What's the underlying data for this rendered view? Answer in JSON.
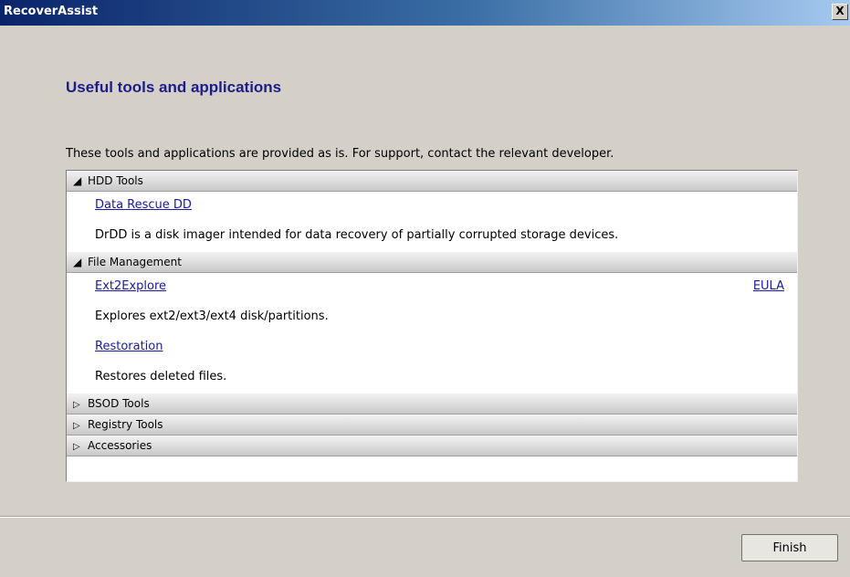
{
  "window": {
    "title": "RecoverAssist",
    "close_glyph": "X"
  },
  "page": {
    "heading": "Useful tools and applications",
    "intro": "These tools and applications are provided as is. For support, contact the relevant developer."
  },
  "groups": [
    {
      "name": "HDD Tools",
      "expanded": true,
      "items": [
        {
          "link": "Data Rescue DD",
          "description": "DrDD is a disk imager intended for data recovery of partially corrupted storage devices."
        }
      ]
    },
    {
      "name": "File Management",
      "expanded": true,
      "items": [
        {
          "link": "Ext2Explore",
          "extra_link": "EULA",
          "description": "Explores ext2/ext3/ext4 disk/partitions."
        },
        {
          "link": "Restoration",
          "description": "Restores deleted files."
        }
      ]
    },
    {
      "name": "BSOD Tools",
      "expanded": false
    },
    {
      "name": "Registry Tools",
      "expanded": false
    },
    {
      "name": "Accessories",
      "expanded": false
    }
  ],
  "footer": {
    "finish_label": "Finish"
  },
  "icons": {
    "expanded": "triangle-down-icon",
    "collapsed": "triangle-right-icon"
  }
}
